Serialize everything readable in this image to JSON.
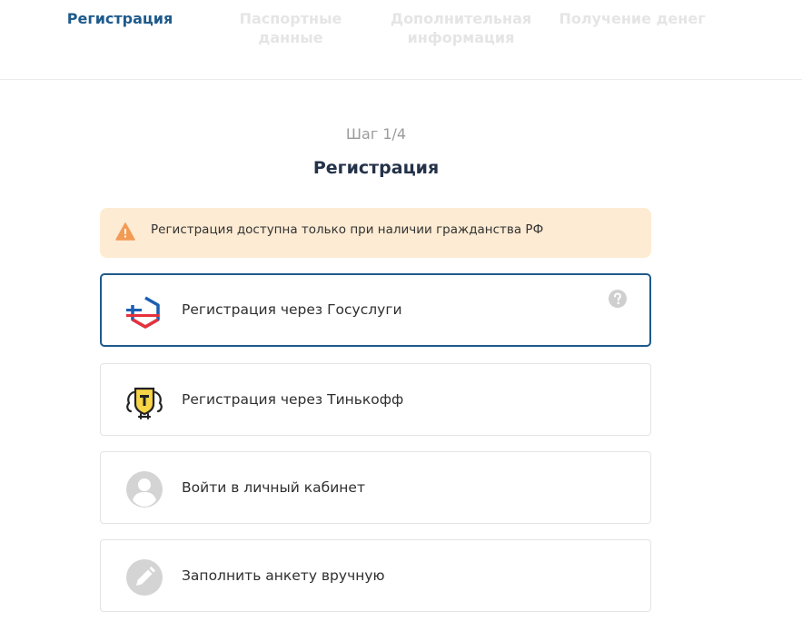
{
  "steps": [
    {
      "label": "Регистрация"
    },
    {
      "label": "Паспортные данные"
    },
    {
      "label": "Дополнительная информация"
    },
    {
      "label": "Получение денег"
    }
  ],
  "main": {
    "step_counter": "Шаг 1/4",
    "title": "Регистрация",
    "alert": "Регистрация доступна только при наличии гражданства РФ",
    "options": [
      {
        "label": "Регистрация через Госуслуги",
        "icon": "gosuslugi-logo-icon"
      },
      {
        "label": "Регистрация через Тинькофф",
        "icon": "tinkoff-logo-icon"
      },
      {
        "label": "Войти в личный кабинет",
        "icon": "user-avatar-icon"
      },
      {
        "label": "Заполнить анкету вручную",
        "icon": "pencil-icon"
      }
    ]
  },
  "colors": {
    "accent": "#1e5a8c",
    "alert_bg": "#fdebd3",
    "warning": "#f39a55",
    "inactive_step": "#e5e5e5"
  }
}
